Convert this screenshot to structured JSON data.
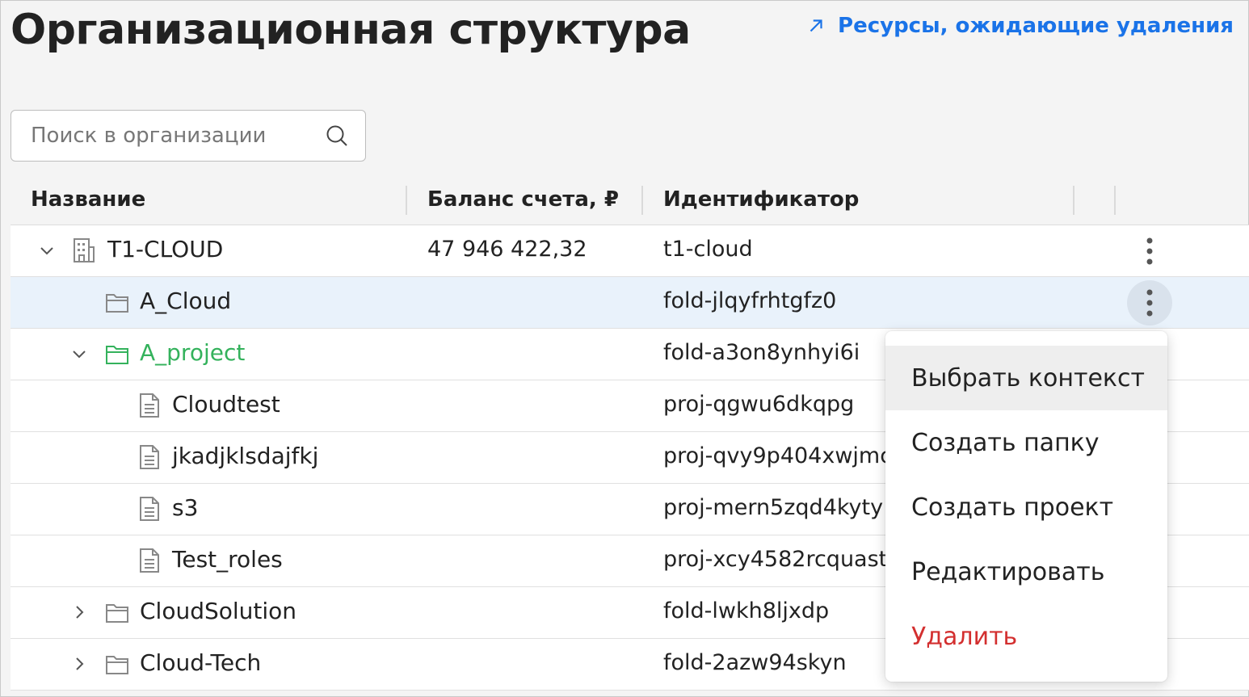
{
  "header": {
    "title": "Организационная структура",
    "pending_link": "Ресурсы, ожидающие удаления"
  },
  "search": {
    "placeholder": "Поиск в организации",
    "value": ""
  },
  "table": {
    "columns": [
      "Название",
      "Баланс счета, ₽",
      "Идентификатор"
    ],
    "rows": [
      {
        "name": "T1-CLOUD",
        "balance": "47 946 422,32",
        "id": "t1-cloud",
        "level": 0,
        "icon": "building-icon",
        "chevron": "down"
      },
      {
        "name": "A_Cloud",
        "balance": "",
        "id": "fold-jlqyfrhtgfz0",
        "level": 1,
        "icon": "folder-icon",
        "chevron": "none"
      },
      {
        "name": "A_project",
        "balance": "",
        "id": "fold-a3on8ynhyi6i",
        "level": 1,
        "icon": "folder-icon",
        "chevron": "down"
      },
      {
        "name": "Cloudtest",
        "balance": "",
        "id": "proj-qgwu6dkqpg",
        "level": 2,
        "icon": "document-icon",
        "chevron": "none"
      },
      {
        "name": "jkadjklsdajfkj",
        "balance": "",
        "id": "proj-qvy9p404xwjmc",
        "level": 2,
        "icon": "document-icon",
        "chevron": "none"
      },
      {
        "name": "s3",
        "balance": "",
        "id": "proj-mern5zqd4kyty",
        "level": 2,
        "icon": "document-icon",
        "chevron": "none"
      },
      {
        "name": "Test_roles",
        "balance": "",
        "id": "proj-xcy4582rcquast",
        "level": 2,
        "icon": "document-icon",
        "chevron": "none"
      },
      {
        "name": "CloudSolution",
        "balance": "",
        "id": "fold-lwkh8ljxdp",
        "level": 1,
        "icon": "folder-icon",
        "chevron": "right"
      },
      {
        "name": "Cloud-Tech",
        "balance": "",
        "id": "fold-2azw94skyn",
        "level": 1,
        "icon": "folder-icon",
        "chevron": "right"
      }
    ]
  },
  "context_menu": {
    "items": [
      "Выбрать контекст",
      "Создать папку",
      "Создать проект",
      "Редактировать",
      "Удалить"
    ]
  },
  "colors": {
    "link": "#1a73e8",
    "green_name": "#34b25c",
    "danger": "#d32f2f",
    "row_highlight": "#e9f2fb"
  }
}
